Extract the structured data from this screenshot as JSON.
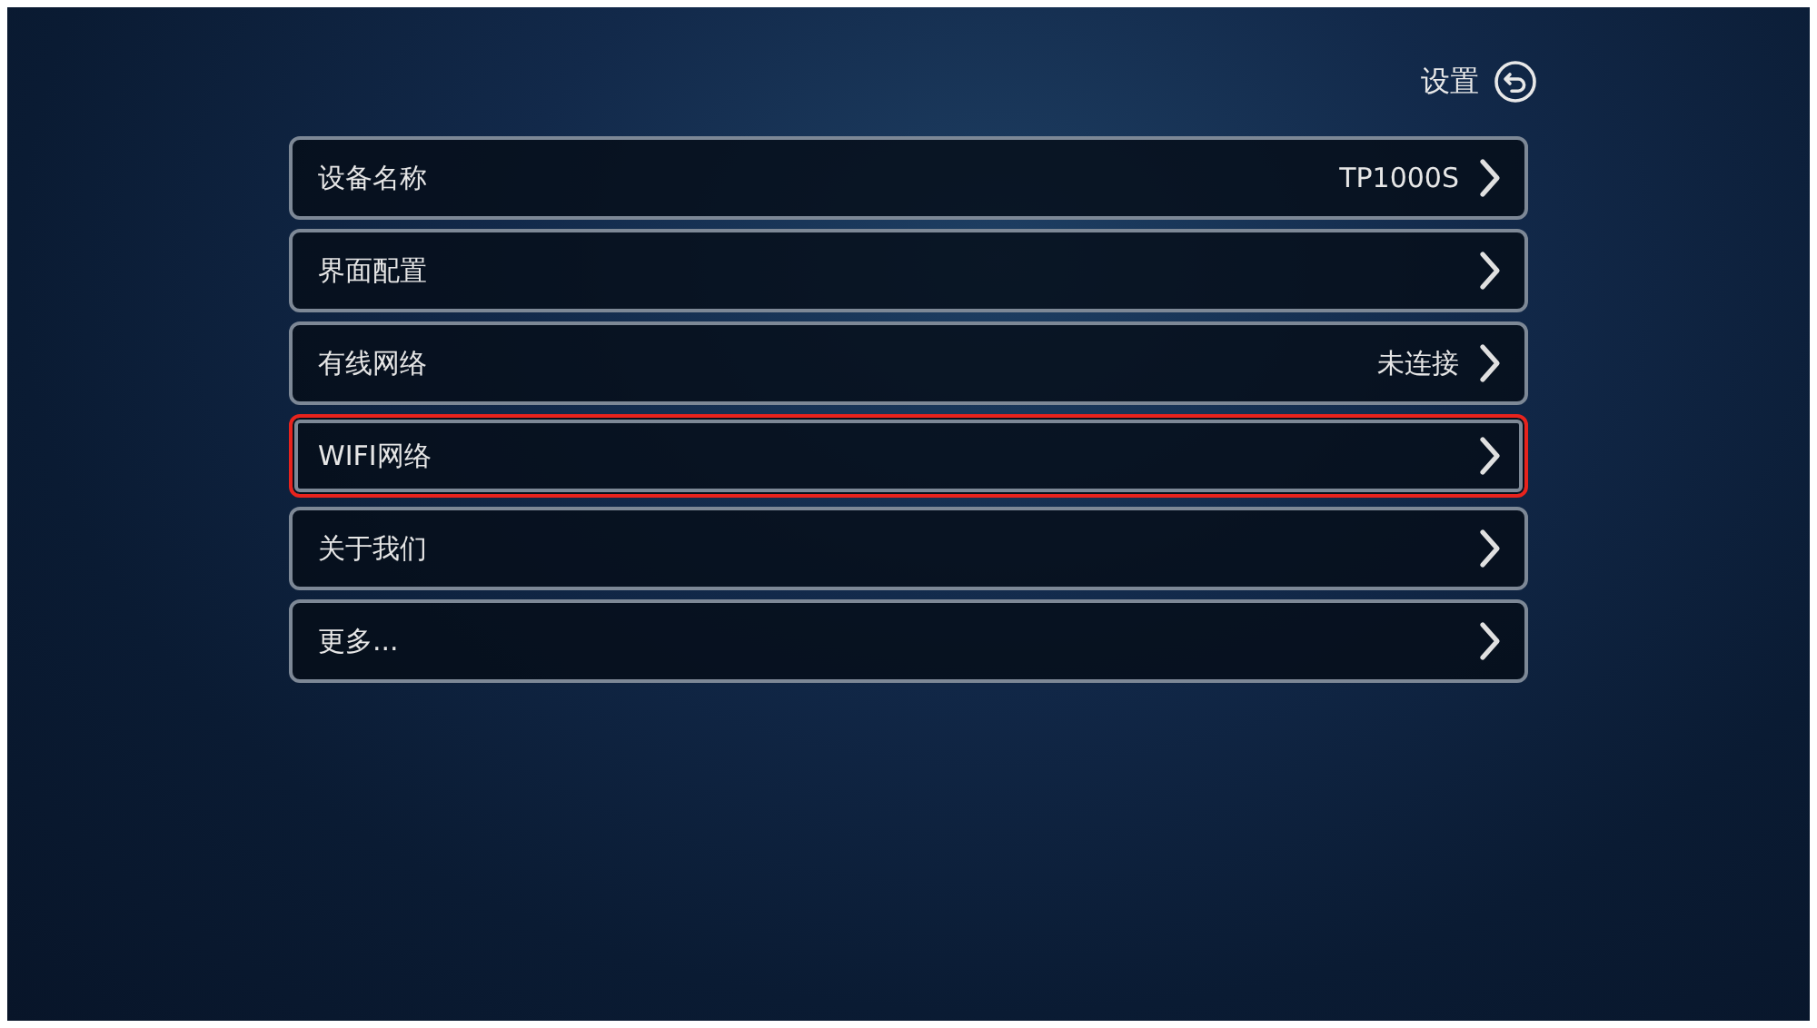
{
  "header": {
    "title": "设置"
  },
  "menu": [
    {
      "label": "设备名称",
      "value": "TP1000S",
      "selected": false
    },
    {
      "label": "界面配置",
      "selected": false
    },
    {
      "label": "有线网络",
      "value": "未连接",
      "selected": false
    },
    {
      "label": "WIFI网络",
      "selected": true
    },
    {
      "label": "关于我们",
      "selected": false
    },
    {
      "label": "更多...",
      "selected": false
    }
  ]
}
